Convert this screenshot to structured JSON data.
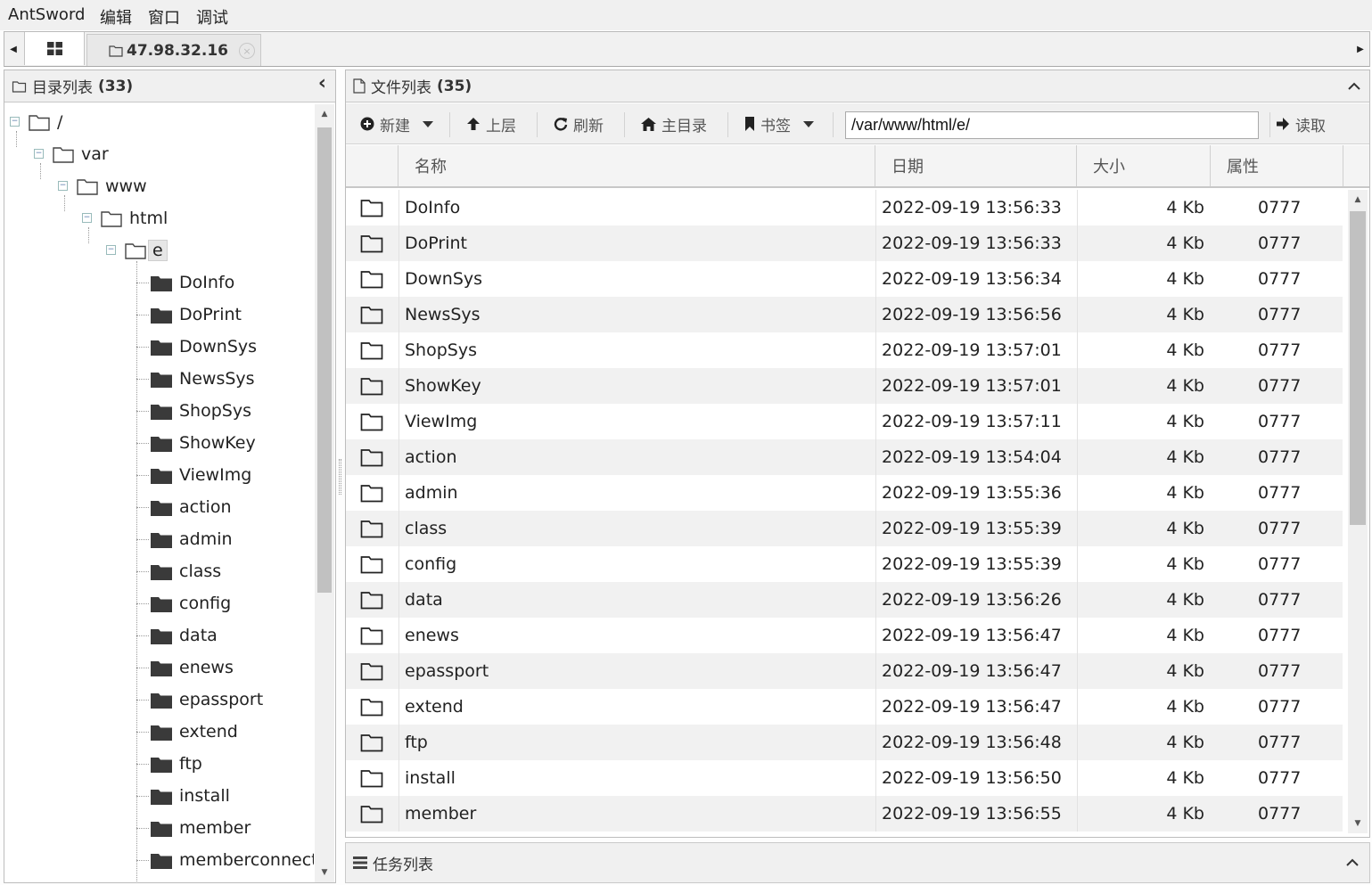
{
  "menubar": {
    "items": [
      "AntSword",
      "编辑",
      "窗口",
      "调试"
    ]
  },
  "tabs": {
    "host_label": "47.98.32.16",
    "close_glyph": "×"
  },
  "left_panel": {
    "title": "目录列表",
    "count": "(33)",
    "collapse_glyph": "‹",
    "tree": [
      {
        "label": "/",
        "depth": 0
      },
      {
        "label": "var",
        "depth": 1
      },
      {
        "label": "www",
        "depth": 2
      },
      {
        "label": "html",
        "depth": 3
      },
      {
        "label": "e",
        "depth": 4,
        "selected": true
      }
    ],
    "children": [
      "DoInfo",
      "DoPrint",
      "DownSys",
      "NewsSys",
      "ShopSys",
      "ShowKey",
      "ViewImg",
      "action",
      "admin",
      "class",
      "config",
      "data",
      "enews",
      "epassport",
      "extend",
      "ftp",
      "install",
      "member",
      "memberconnect"
    ]
  },
  "right_panel": {
    "title": "文件列表",
    "count": "(35)",
    "toolbar": {
      "new_label": "新建",
      "up_label": "上层",
      "refresh_label": "刷新",
      "home_label": "主目录",
      "bookmark_label": "书签",
      "path_value": "/var/www/html/e/",
      "read_label": "读取"
    },
    "columns": [
      "名称",
      "日期",
      "大小",
      "属性"
    ],
    "files": [
      {
        "name": "DoInfo",
        "date": "2022-09-19 13:56:33",
        "size": "4 Kb",
        "attr": "0777"
      },
      {
        "name": "DoPrint",
        "date": "2022-09-19 13:56:33",
        "size": "4 Kb",
        "attr": "0777"
      },
      {
        "name": "DownSys",
        "date": "2022-09-19 13:56:34",
        "size": "4 Kb",
        "attr": "0777"
      },
      {
        "name": "NewsSys",
        "date": "2022-09-19 13:56:56",
        "size": "4 Kb",
        "attr": "0777"
      },
      {
        "name": "ShopSys",
        "date": "2022-09-19 13:57:01",
        "size": "4 Kb",
        "attr": "0777"
      },
      {
        "name": "ShowKey",
        "date": "2022-09-19 13:57:01",
        "size": "4 Kb",
        "attr": "0777"
      },
      {
        "name": "ViewImg",
        "date": "2022-09-19 13:57:11",
        "size": "4 Kb",
        "attr": "0777"
      },
      {
        "name": "action",
        "date": "2022-09-19 13:54:04",
        "size": "4 Kb",
        "attr": "0777"
      },
      {
        "name": "admin",
        "date": "2022-09-19 13:55:36",
        "size": "4 Kb",
        "attr": "0777"
      },
      {
        "name": "class",
        "date": "2022-09-19 13:55:39",
        "size": "4 Kb",
        "attr": "0777"
      },
      {
        "name": "config",
        "date": "2022-09-19 13:55:39",
        "size": "4 Kb",
        "attr": "0777"
      },
      {
        "name": "data",
        "date": "2022-09-19 13:56:26",
        "size": "4 Kb",
        "attr": "0777"
      },
      {
        "name": "enews",
        "date": "2022-09-19 13:56:47",
        "size": "4 Kb",
        "attr": "0777"
      },
      {
        "name": "epassport",
        "date": "2022-09-19 13:56:47",
        "size": "4 Kb",
        "attr": "0777"
      },
      {
        "name": "extend",
        "date": "2022-09-19 13:56:47",
        "size": "4 Kb",
        "attr": "0777"
      },
      {
        "name": "ftp",
        "date": "2022-09-19 13:56:48",
        "size": "4 Kb",
        "attr": "0777"
      },
      {
        "name": "install",
        "date": "2022-09-19 13:56:50",
        "size": "4 Kb",
        "attr": "0777"
      },
      {
        "name": "member",
        "date": "2022-09-19 13:56:55",
        "size": "4 Kb",
        "attr": "0777"
      }
    ]
  },
  "task_panel": {
    "title": "任务列表"
  },
  "icons": {
    "grid": "grid-icon",
    "folder_outline": "folder-outline-icon",
    "folder_solid": "folder-solid-icon",
    "file": "file-icon",
    "plus": "plus-circle-icon",
    "arrow_up": "arrow-up-icon",
    "refresh": "refresh-icon",
    "home": "home-icon",
    "bookmark": "bookmark-icon",
    "arrow_right": "arrow-right-icon",
    "tasks": "tasks-icon"
  }
}
